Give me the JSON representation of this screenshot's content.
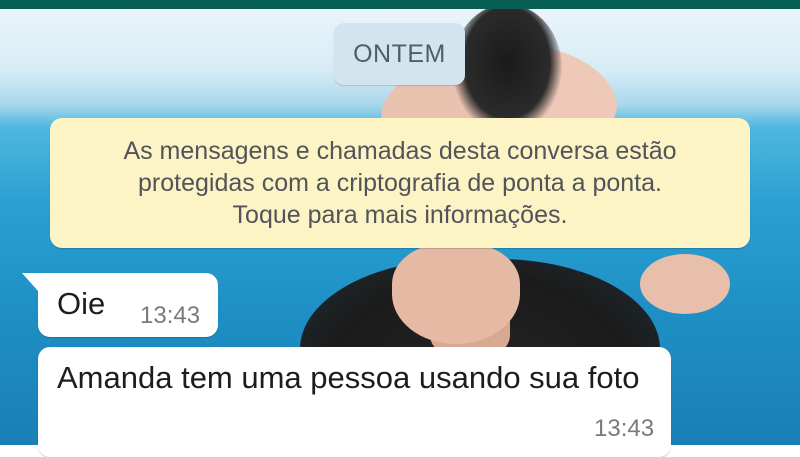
{
  "header": {
    "bar_color": "#075e54"
  },
  "chat": {
    "date_separator": "ONTEM",
    "encryption_notice": {
      "line1": "As mensagens e chamadas desta conversa estão",
      "line2": "protegidas com a criptografia de ponta a ponta.",
      "line3": "Toque para mais informações."
    },
    "messages": [
      {
        "text": "Oie",
        "time": "13:43",
        "direction": "incoming"
      },
      {
        "text": "Amanda tem uma pessoa usando sua foto",
        "time": "13:43",
        "direction": "incoming"
      }
    ]
  },
  "colors": {
    "notice_background": "#fcf4c4",
    "date_chip_background": "#d4e4ee",
    "bubble_background": "#ffffff"
  }
}
